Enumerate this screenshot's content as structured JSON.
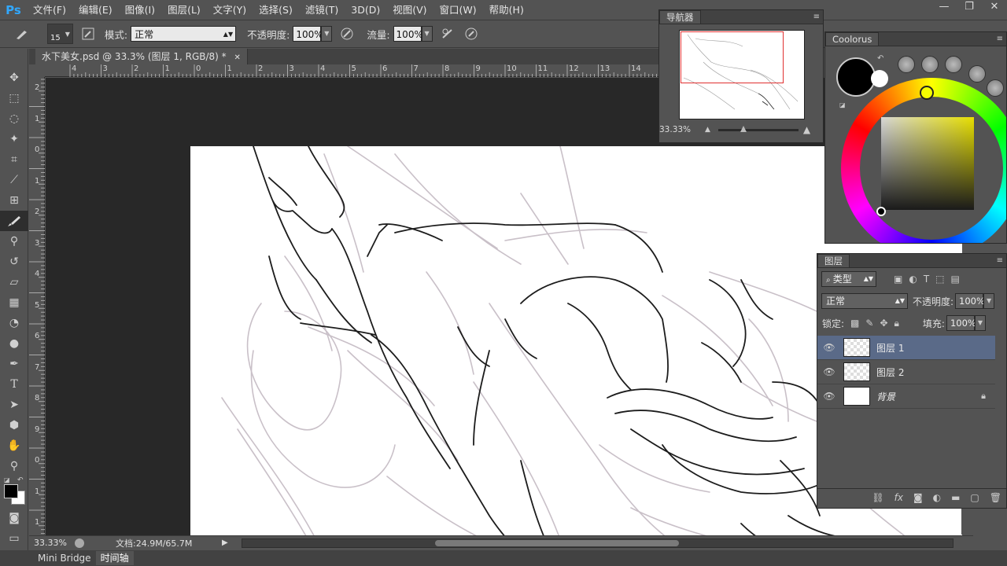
{
  "app": {
    "logo": "Ps"
  },
  "menu": [
    "文件(F)",
    "编辑(E)",
    "图像(I)",
    "图层(L)",
    "文字(Y)",
    "选择(S)",
    "滤镜(T)",
    "3D(D)",
    "视图(V)",
    "窗口(W)",
    "帮助(H)"
  ],
  "window_controls": {
    "minimize": "—",
    "restore": "❐",
    "close": "✕"
  },
  "options": {
    "brush_size": "15",
    "mode_label": "模式:",
    "mode_value": "正常",
    "opacity_label": "不透明度:",
    "opacity_value": "100%",
    "flow_label": "流量:",
    "flow_value": "100%"
  },
  "document": {
    "tab_title": "水下美女.psd @ 33.3% (图层 1, RGB/8) *",
    "tab_close": "✕"
  },
  "rulers": {
    "h_ticks": [
      "4",
      "3",
      "2",
      "1",
      "0",
      "1",
      "2",
      "3",
      "4",
      "5",
      "6",
      "7",
      "8",
      "9",
      "10",
      "11",
      "12",
      "13",
      "14"
    ],
    "v_ticks": [
      "2",
      "1",
      "0",
      "1",
      "2",
      "3",
      "4",
      "5",
      "6",
      "7",
      "8",
      "9",
      "0",
      "1",
      "1",
      "2"
    ]
  },
  "status": {
    "zoom": "33.33%",
    "doc_info": "文档:24.9M/65.7M"
  },
  "bottom_tabs": [
    "Mini Bridge",
    "时间轴"
  ],
  "navigator": {
    "title": "导航器",
    "zoom": "33.33%"
  },
  "coolorus": {
    "title": "Coolorus",
    "hue_color": "#f5ff00",
    "fg_color": "#000000",
    "bg_color": "#ffffff"
  },
  "layers": {
    "title": "图层",
    "filter_label": "类型",
    "blend_mode": "正常",
    "opacity_label": "不透明度:",
    "opacity_value": "100%",
    "lock_label": "锁定:",
    "fill_label": "填充:",
    "fill_value": "100%",
    "items": [
      {
        "name": "图层 1",
        "active": true
      },
      {
        "name": "图层 2",
        "active": false
      },
      {
        "name": "背景",
        "active": false,
        "locked": true
      }
    ]
  },
  "icons": {
    "eye": "eye-icon",
    "lock": "lock-icon",
    "brush": "brush-icon"
  }
}
